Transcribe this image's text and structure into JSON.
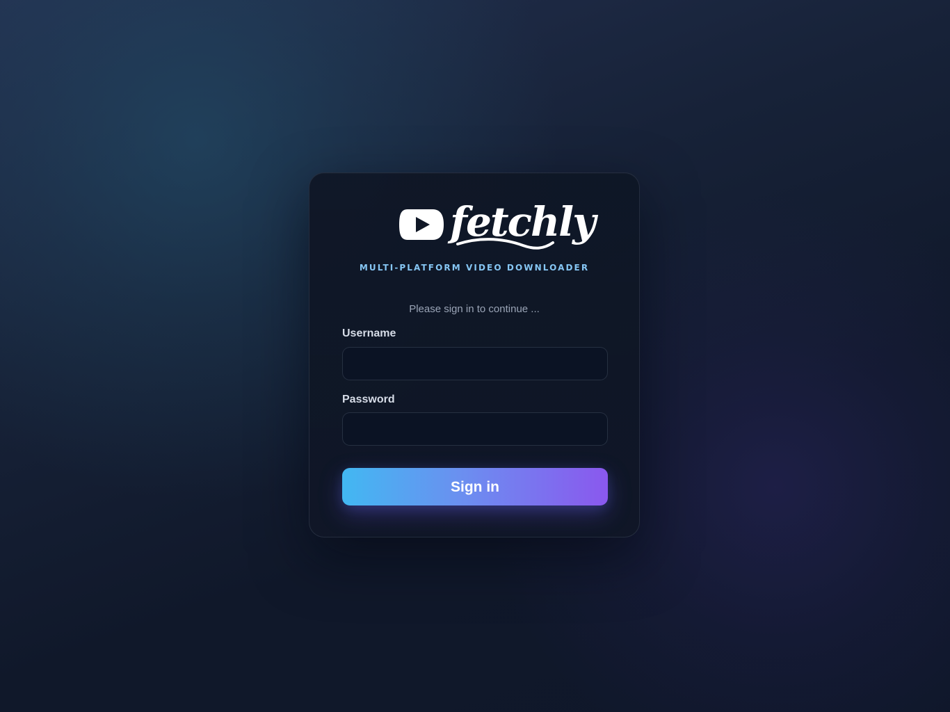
{
  "brand": {
    "name": "fetchly",
    "logo_icon": "play-icon",
    "tagline": "MULTI-PLATFORM VIDEO DOWNLOADER"
  },
  "login": {
    "prompt": "Please sign in to continue ...",
    "username": {
      "label": "Username",
      "value": "",
      "placeholder": ""
    },
    "password": {
      "label": "Password",
      "value": "",
      "placeholder": ""
    },
    "submit_label": "Sign in"
  },
  "colors": {
    "background": "#111829",
    "card": "#0f1726",
    "input_background": "#0b1324",
    "tagline": "#86c6f4",
    "button_start": "#42b8f2",
    "button_end": "#8a58ee"
  }
}
